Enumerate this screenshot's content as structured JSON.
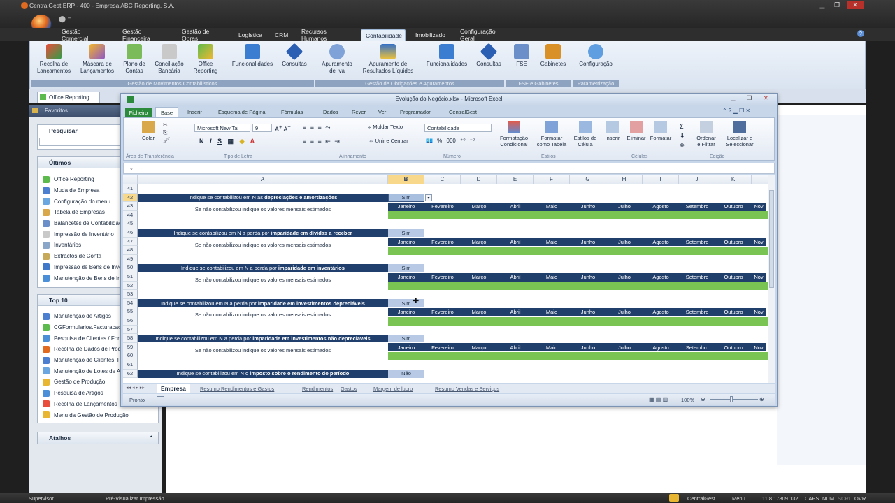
{
  "app": {
    "title": "CentralGest ERP - 400 - Empresa ABC Reporting, S.A."
  },
  "tabs": [
    "Gestão Comercial",
    "Gestão Financeira",
    "Gestão de Obras",
    "Logística",
    "CRM",
    "Recursos Humanos",
    "Contabilidade",
    "Imobilizado",
    "Configuração Geral"
  ],
  "ribbon": {
    "groups": [
      {
        "label": "Gestão de Movimentos Contabilísticos",
        "buttons": [
          "Recolha de\nLançamentos",
          "Máscara de\nLançamentos",
          "Plano de\nContas",
          "Conciliação\nBancária",
          "Office\nReporting",
          "Funcionalidades",
          "Consultas"
        ]
      },
      {
        "label": "Gestão de Obrigações e Apuramentos",
        "buttons": [
          "Apuramento\nde Iva",
          "Apuramento de\nResultados Líquidos",
          "Funcionalidades",
          "Consultas"
        ]
      },
      {
        "label": "FSE e Gabinetes",
        "buttons": [
          "FSE",
          "Gabinetes"
        ]
      },
      {
        "label": "Parametrização",
        "buttons": [
          "Configuração"
        ]
      }
    ]
  },
  "doc_tab": "Office Reporting",
  "favoritos": "Favoritos",
  "search": {
    "label": "Pesquisar"
  },
  "ultimos": {
    "title": "Últimos",
    "items": [
      "Office Reporting",
      "Muda de Empresa",
      "Configuração do menu",
      "Tabela de Empresas",
      "Balancetes de Contabilidade",
      "Impressão de Inventário",
      "Inventários",
      "Extractos de Conta",
      "Impressão de Bens de Investimento",
      "Manutenção de Bens de Investimento"
    ]
  },
  "top10": {
    "title": "Top 10",
    "items": [
      "Manutenção de Artigos",
      "CGFormularios.FacturacaoRecolha",
      "Pesquisa de Clientes / Fornecedores",
      "Recolha de Dados de Produção",
      "Manutenção de Clientes, Fornecedores",
      "Manutenção de Lotes de Artigos",
      "Gestão de Produção",
      "Pesquisa de Artigos",
      "Recolha de Lançamentos",
      "Menu da Gestão de Produção"
    ]
  },
  "atalhos": {
    "title": "Atalhos"
  },
  "status": {
    "user": "Supervisor",
    "mode": "Pré-Visualizar Impressão",
    "app": "CentralGest",
    "menu": "Menu",
    "version": "11.8.17809.132",
    "caps": "CAPS",
    "num": "NUM",
    "scrl": "SCRL",
    "ovr": "OVR"
  },
  "excel": {
    "title": "Evolução do Negócio.xlsx - Microsoft Excel",
    "file": "Ficheiro",
    "tabs": [
      "Base",
      "Inserir",
      "Esquema de Página",
      "Fórmulas",
      "Dados",
      "Rever",
      "Ver",
      "Programador",
      "CentralGest"
    ],
    "font": "Microsoft New Tai",
    "size": "9",
    "wrap": "Moldar Texto",
    "merge": "Unir e Centrar",
    "numfmt": "Contabilidade",
    "paste": "Colar",
    "groups": [
      "Área de Transferência",
      "Tipo de Letra",
      "Alinhamento",
      "Número",
      "Estilos",
      "Células",
      "Edição"
    ],
    "buttons": [
      "Formatação\nCondicional",
      "Formatar\ncomo Tabela",
      "Estilos de\nCélula",
      "Inserir",
      "Eliminar",
      "Formatar",
      "Ordenar\ne Filtrar",
      "Localizar e\nSeleccionar"
    ],
    "columns": [
      "A",
      "B",
      "C",
      "D",
      "E",
      "F",
      "G",
      "H",
      "I",
      "J",
      "K"
    ],
    "months": [
      "Janeiro",
      "Fevereiro",
      "Março",
      "Abril",
      "Maio",
      "Junho",
      "Julho",
      "Agosto",
      "Setembro",
      "Outubro",
      "Nov"
    ],
    "rows": [
      "41",
      "42",
      "43",
      "44",
      "45",
      "46",
      "47",
      "48",
      "49",
      "50",
      "51",
      "52",
      "53",
      "54",
      "55",
      "56",
      "57",
      "58",
      "59",
      "60",
      "61",
      "62"
    ],
    "blocks": [
      {
        "q_pre": "Indique se contabilizou em N as ",
        "q_bold": "depreciações e amortizações",
        "answer": "Sim"
      },
      {
        "q_pre": "Indique se contabilizou em N a perda por ",
        "q_bold": "imparidade em dívidas a receber",
        "answer": "Sim"
      },
      {
        "q_pre": "Indique se contabilizou em N a perda por ",
        "q_bold": "imparidade em inventários",
        "answer": "Sim"
      },
      {
        "q_pre": "Indique se contabilizou em N a perda por ",
        "q_bold": "imparidade em investimentos depreciáveis",
        "answer": "Sim"
      },
      {
        "q_pre": "Indique se contabilizou em N a perda por ",
        "q_bold": "imparidade em investimentos não depreciáveis",
        "answer": "Sim"
      },
      {
        "q_pre": "Indique se contabilizou em N o ",
        "q_bold": "imposto sobre o rendimento do período",
        "answer": "Não"
      }
    ],
    "sub": "Se não contabilizou indique os valores mensais estimados",
    "sheets": [
      "Empresa",
      "Resumo Rendimentos e Gastos",
      "Rendimentos",
      "Gastos",
      "Margem de lucro",
      "Resumo Vendas e Serviços"
    ],
    "ready": "Pronto",
    "zoom": "100%"
  }
}
